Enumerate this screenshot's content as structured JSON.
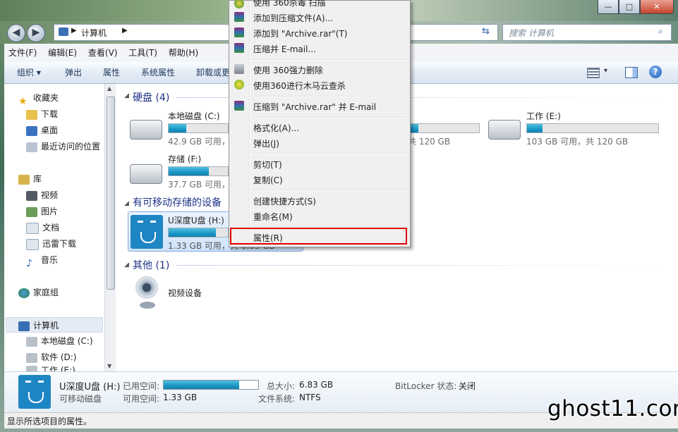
{
  "window": {
    "caption_buttons": [
      "—",
      "□",
      "✕"
    ],
    "back_glyph": "◀",
    "forward_glyph": "▶",
    "breadcrumb": "计算机",
    "search_placeholder": "搜索 计算机"
  },
  "menubar": [
    "文件(F)",
    "编辑(E)",
    "查看(V)",
    "工具(T)",
    "帮助(H)"
  ],
  "toolbar": [
    "组织 ▾",
    "弹出",
    "属性",
    "系统属性",
    "卸载或更"
  ],
  "navpane": {
    "favorites": "收藏夹",
    "favorite_items": [
      "下载",
      "桌面",
      "最近访问的位置"
    ],
    "libraries": "库",
    "library_items": [
      "视频",
      "图片",
      "文档",
      "迅雷下载",
      "音乐"
    ],
    "homegroup": "家庭组",
    "computer": "计算机",
    "computer_items": [
      "本地磁盘 (C:)",
      "软件 (D:)",
      "工作 (E:)"
    ]
  },
  "groups": {
    "hdd_header": "硬盘 (4)",
    "removable_header": "有可移动存储的设备",
    "other_header": "其他 (1)"
  },
  "drives": [
    {
      "name": "本地磁盘 (C:)",
      "info": "42.9 GB 可用，",
      "fill": 0.3
    },
    {
      "name": "",
      "info": "共 120 GB",
      "fill": 0.12
    },
    {
      "name": "工作 (E:)",
      "info": "103 GB 可用，共 120 GB",
      "fill": 0.12
    },
    {
      "name": "存储 (F:)",
      "info": "37.7 GB 可用，",
      "fill": 0.68
    },
    {
      "name": "U深度U盘 (H:)",
      "info": "1.33 GB 可用，共 6.83 GB",
      "fill": 0.8
    }
  ],
  "other_device": "视频设备",
  "context_menu": {
    "items": [
      "使用 360杀毒 扫描",
      "添加到压缩文件(A)...",
      "添加到 \"Archive.rar\"(T)",
      "压缩并 E-mail...",
      "使用 360强力删除",
      "使用360进行木马云查杀",
      "压缩到 \"Archive.rar\" 并 E-mail",
      "格式化(A)...",
      "弹出(J)",
      "剪切(T)",
      "复制(C)",
      "创建快捷方式(S)",
      "重命名(M)",
      "属性(R)"
    ]
  },
  "details": {
    "name": "U深度U盘 (H:)",
    "type": "可移动磁盘",
    "used_label": "已用空间:",
    "used_fill": 0.8,
    "free_label": "可用空间:",
    "free_value": "1.33 GB",
    "total_label": "总大小:",
    "total_value": "6.83 GB",
    "fs_label": "文件系统:",
    "fs_value": "NTFS",
    "bitlocker_label": "BitLocker 状态:",
    "bitlocker_value": "关闭"
  },
  "statusbar": "显示所选项目的属性。",
  "watermark": "ghost11.com",
  "colors": {
    "accent_bar": "#1a97c5",
    "highlight_border": "#e00000",
    "group_header": "#1e3287"
  }
}
